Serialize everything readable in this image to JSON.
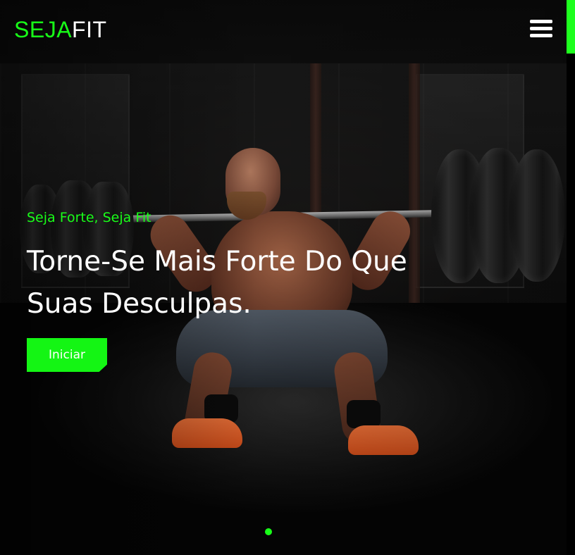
{
  "header": {
    "logo_part1": "SEJA",
    "logo_part2": "FIT",
    "menu_icon": "hamburger-menu-icon"
  },
  "hero": {
    "subtitle": "Seja Forte, Seja Fit",
    "headline": "Torne-Se Mais Forte Do Que Suas Desculpas.",
    "cta_label": "Iniciar",
    "slide_count": 1,
    "active_slide": 1
  },
  "colors": {
    "accent": "#18ff18",
    "text": "#ffffff",
    "background": "#000000"
  }
}
